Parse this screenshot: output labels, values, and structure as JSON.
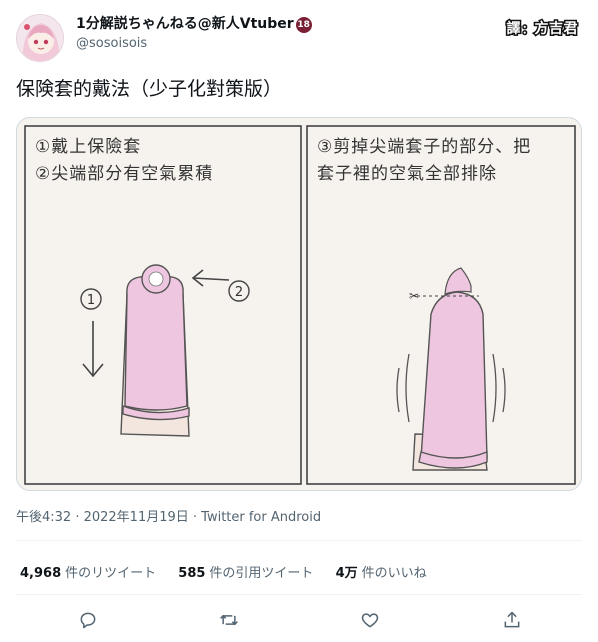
{
  "tweet": {
    "display_name": "1分解説ちゃんねる@新人Vtuber",
    "age_badge": "18",
    "handle": "@sosoisois",
    "text": "保険套的戴法（少子化對策版）",
    "timestamp": "午後4:32 · 2022年11月19日 · Twitter for Android"
  },
  "watermark": {
    "left": "譯",
    "separator": "：",
    "right": "方吉君"
  },
  "image": {
    "left_panel": {
      "line1": "①戴上保險套",
      "line2": "②尖端部分有空氣累積"
    },
    "right_panel": {
      "line1": "③剪掉尖端套子的部分、把",
      "line2": "套子裡的空氣全部排除"
    },
    "arrow_label_1": "①",
    "arrow_label_2": "②"
  },
  "stats": [
    {
      "count": "4,968",
      "label": "件のリツイート"
    },
    {
      "count": "585",
      "label": "件の引用ツイート"
    },
    {
      "count": "4万",
      "label": "件のいいね"
    }
  ],
  "actions": {
    "reply_icon": "reply-icon",
    "retweet_icon": "retweet-icon",
    "like_icon": "heart-icon",
    "share_icon": "share-icon"
  },
  "colors": {
    "condom_pink": "#eec6df",
    "text_primary": "#0f1419",
    "text_secondary": "#536471"
  }
}
